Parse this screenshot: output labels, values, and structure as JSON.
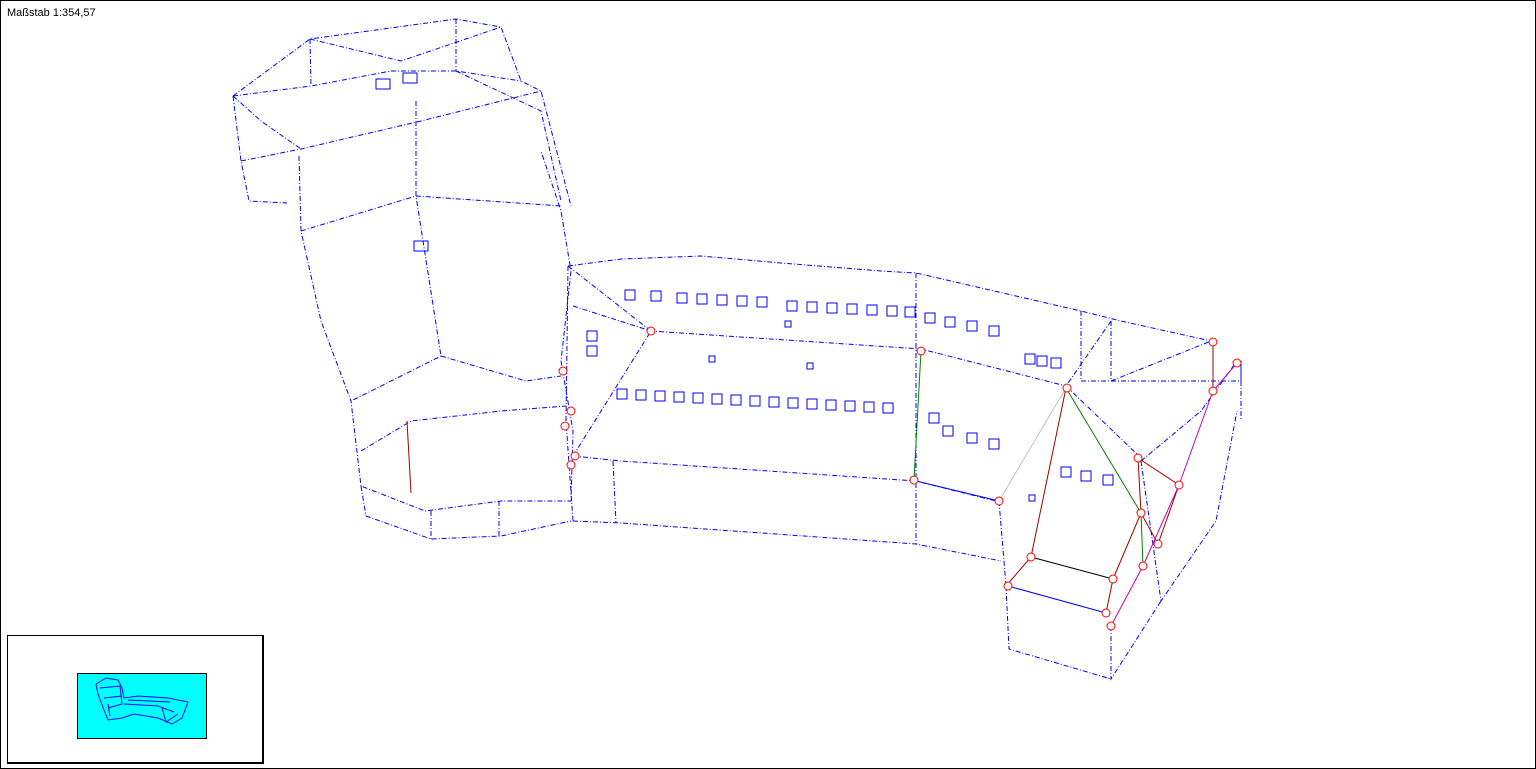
{
  "viewport": {
    "scale_label": "Maßstab 1:354,57"
  },
  "colors": {
    "wireframe": "#0000ff",
    "node_marker": "#ff0000",
    "edge_red": "#a00000",
    "edge_green": "#008000",
    "edge_magenta": "#c000c0",
    "overview_background": "#00ffff"
  }
}
